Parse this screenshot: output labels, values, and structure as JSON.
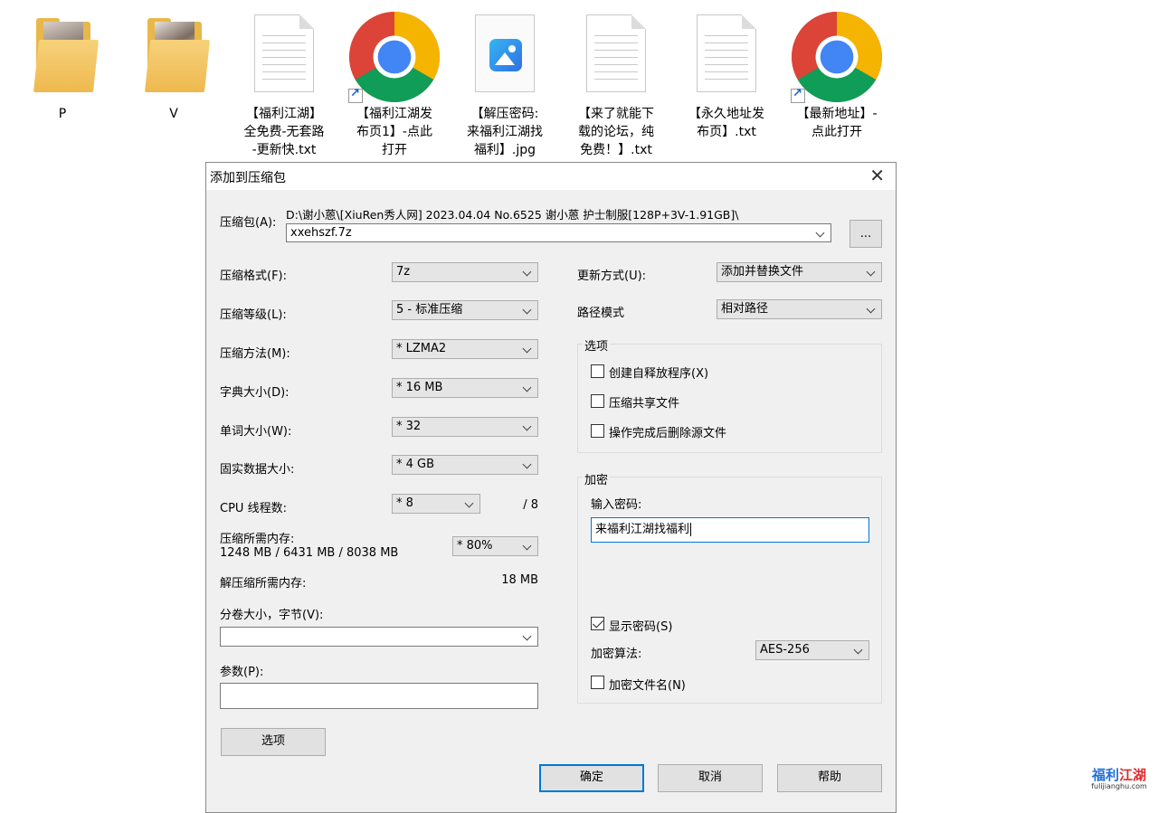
{
  "desktop": {
    "icons": [
      {
        "label": "P",
        "type": "folder"
      },
      {
        "label": "V",
        "type": "folder"
      },
      {
        "label": "【福利江湖】\n全免费-无套路\n-更新快.txt",
        "type": "text-file"
      },
      {
        "label": "【福利江湖发\n布页1】-点此\n打开",
        "type": "chrome-shortcut"
      },
      {
        "label": "【解压密码:\n来福利江湖找\n福利】.jpg",
        "type": "image-file"
      },
      {
        "label": "【来了就能下\n载的论坛，纯\n免费！】.txt",
        "type": "text-file"
      },
      {
        "label": "【永久地址发\n布页】.txt",
        "type": "text-file"
      },
      {
        "label": "【最新地址】-\n点此打开",
        "type": "chrome-shortcut"
      }
    ]
  },
  "dialog": {
    "title": "添加到压缩包",
    "archive": {
      "label": "压缩包(A):",
      "path": "D:\\谢小蒽\\[XiuRen秀人网] 2023.04.04 No.6525 谢小蒽 护士制服[128P+3V-1.91GB]\\",
      "filename": "xxehszf.7z",
      "browse_label": "..."
    },
    "left": {
      "format": {
        "label": "压缩格式(F):",
        "value": "7z"
      },
      "level": {
        "label": "压缩等级(L):",
        "value": "5 - 标准压缩"
      },
      "method": {
        "label": "压缩方法(M):",
        "value": "* LZMA2"
      },
      "dict": {
        "label": "字典大小(D):",
        "value": "* 16 MB"
      },
      "word": {
        "label": "单词大小(W):",
        "value": "* 32"
      },
      "solid": {
        "label": "固实数据大小:",
        "value": "* 4 GB"
      },
      "threads": {
        "label": "CPU 线程数:",
        "value": "* 8",
        "max": "/ 8"
      },
      "memory": {
        "label": "压缩所需内存:",
        "detail": "1248 MB / 6431 MB / 8038 MB",
        "value": "* 80%"
      },
      "decompress_memory": {
        "label": "解压缩所需内存:",
        "value": "18 MB"
      },
      "split": {
        "label": "分卷大小，字节(V):",
        "value": ""
      },
      "params": {
        "label": "参数(P):",
        "value": ""
      },
      "options_button": "选项"
    },
    "right": {
      "update": {
        "label": "更新方式(U):",
        "value": "添加并替换文件"
      },
      "path_mode": {
        "label": "路径模式",
        "value": "相对路径"
      },
      "options_group": {
        "title": "选项",
        "sfx": {
          "label": "创建自释放程序(X)",
          "checked": false
        },
        "shared": {
          "label": "压缩共享文件",
          "checked": false
        },
        "delete": {
          "label": "操作完成后删除源文件",
          "checked": false
        }
      },
      "encryption_group": {
        "title": "加密",
        "password_label": "输入密码:",
        "password_value": "来福利江湖找福利",
        "show_password": {
          "label": "显示密码(S)",
          "checked": true
        },
        "method_label": "加密算法:",
        "method_value": "AES-256",
        "encrypt_names": {
          "label": "加密文件名(N)",
          "checked": false
        }
      }
    },
    "buttons": {
      "ok": "确定",
      "cancel": "取消",
      "help": "帮助"
    }
  },
  "watermark": {
    "brand_blue": "福利",
    "brand_red": "江湖",
    "url": "fulijianghu.com"
  },
  "colors": {
    "accent": "#0078d7",
    "dialog_bg": "#f0f0f0"
  }
}
